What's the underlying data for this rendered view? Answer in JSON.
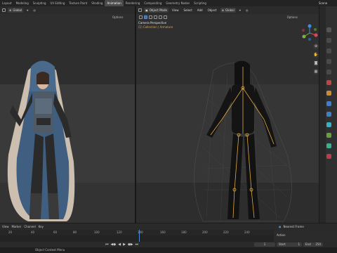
{
  "workspace_tabs": [
    "Layout",
    "Modeling",
    "Sculpting",
    "UV Editing",
    "Texture Paint",
    "Shading",
    "Animation",
    "Rendering",
    "Compositing",
    "Geometry Nodes",
    "Scripting"
  ],
  "active_tab": "Animation",
  "scene_label": "Scene",
  "left_header": {
    "transform": "Global",
    "options": "Options"
  },
  "right_header": {
    "mode": "Object Mode",
    "menus": [
      "View",
      "Select",
      "Add",
      "Object"
    ],
    "transform": "Global",
    "options": "Options"
  },
  "camera_label": "Camera Perspective",
  "collection_label": "(1) Collection | Armature",
  "gizmo": {
    "x_color": "#e0465a",
    "y_color": "#7cb342",
    "z_color": "#3d8fe0"
  },
  "timeline": {
    "menus": [
      "View",
      "Marker",
      "Channel",
      "Key"
    ],
    "ticks": [
      "20",
      "40",
      "60",
      "80",
      "100",
      "120",
      "140",
      "160",
      "180",
      "200",
      "220",
      "240"
    ],
    "keying": "Nearest Frame",
    "action_label": "Action",
    "current_frame": "1",
    "start_label": "Start",
    "start_value": "1",
    "end_label": "End",
    "end_value": "250"
  },
  "status_text": "Object Context Menu",
  "accent": "#4d8bd1",
  "collection_color": "#e1a840"
}
